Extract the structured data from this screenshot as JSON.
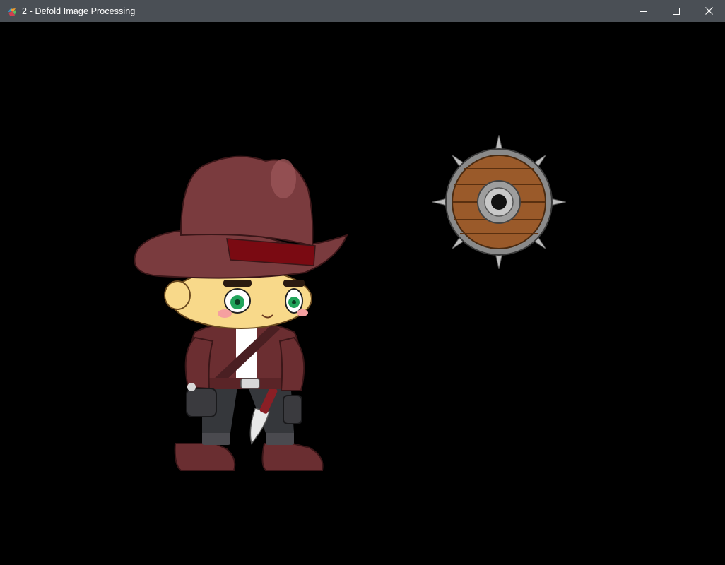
{
  "window": {
    "title": "2 - Defold Image Processing",
    "icon": "defold-app-icon",
    "controls": [
      "minimize-icon",
      "maximize-icon",
      "close-icon"
    ]
  },
  "game": {
    "background": "#000000",
    "sprites": [
      "cowboy-character",
      "spiked-wooden-shield"
    ]
  }
}
